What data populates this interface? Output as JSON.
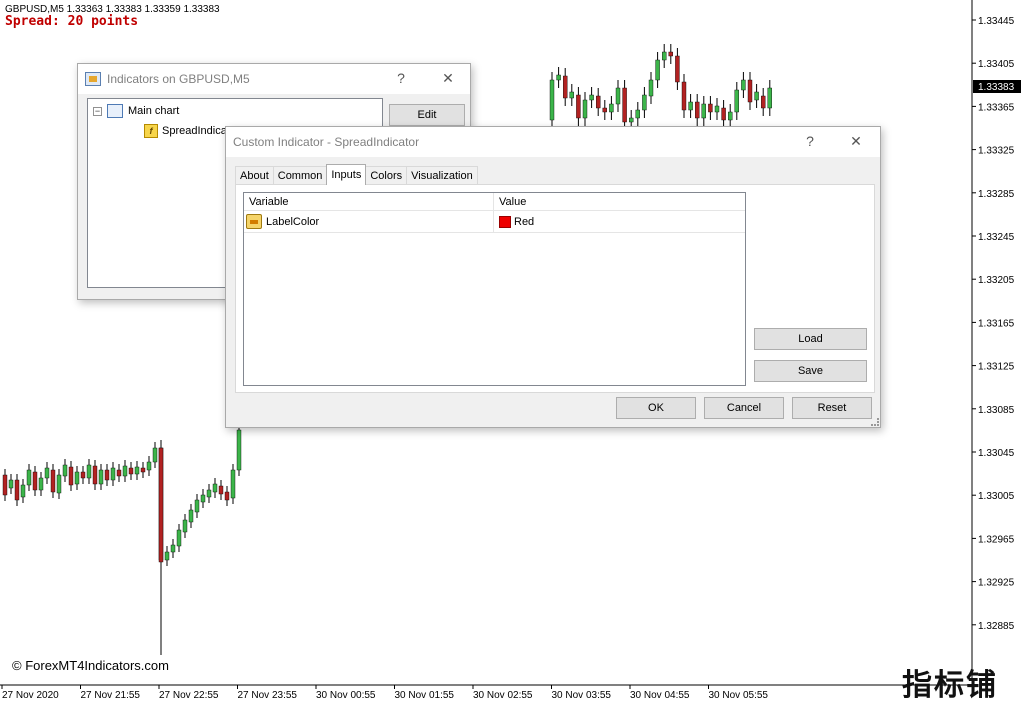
{
  "chart": {
    "header": "GBPUSD,M5  1.33363 1.33383 1.33359 1.33383",
    "spread_label": "Spread: 20 points",
    "price_labels": [
      "1.33445",
      "1.33405",
      "1.33365",
      "1.33325",
      "1.33285",
      "1.33245",
      "1.33205",
      "1.33165",
      "1.33125",
      "1.33085",
      "1.33045",
      "1.33005",
      "1.32965",
      "1.32925",
      "1.32885"
    ],
    "current_price": "1.33383",
    "time_labels": [
      "27 Nov 2020",
      "27 Nov 21:55",
      "27 Nov 22:55",
      "27 Nov 23:55",
      "30 Nov 00:55",
      "30 Nov 01:55",
      "30 Nov 02:55",
      "30 Nov 03:55",
      "30 Nov 04:55",
      "30 Nov 05:55"
    ],
    "copyright": "© ForexMT4Indicators.com",
    "watermark": "指标铺",
    "colors": {
      "bull": "#3cb54a",
      "bear": "#b22222",
      "current_price_bg": "#000000"
    }
  },
  "indicators_dialog": {
    "title": "Indicators on GBPUSD,M5",
    "help": "?",
    "close": "✕",
    "tree": {
      "root": "Main chart",
      "child": "SpreadIndicator"
    },
    "edit_button": "Edit"
  },
  "custom_dialog": {
    "title": "Custom Indicator - SpreadIndicator",
    "help": "?",
    "close": "✕",
    "tabs": [
      "About",
      "Common",
      "Inputs",
      "Colors",
      "Visualization"
    ],
    "active_tab": "Inputs",
    "table": {
      "headers": [
        "Variable",
        "Value"
      ],
      "rows": [
        {
          "variable": "LabelColor",
          "value": "Red",
          "color": "#ee0000"
        }
      ]
    },
    "load_button": "Load",
    "save_button": "Save",
    "ok_button": "OK",
    "cancel_button": "Cancel",
    "reset_button": "Reset"
  }
}
